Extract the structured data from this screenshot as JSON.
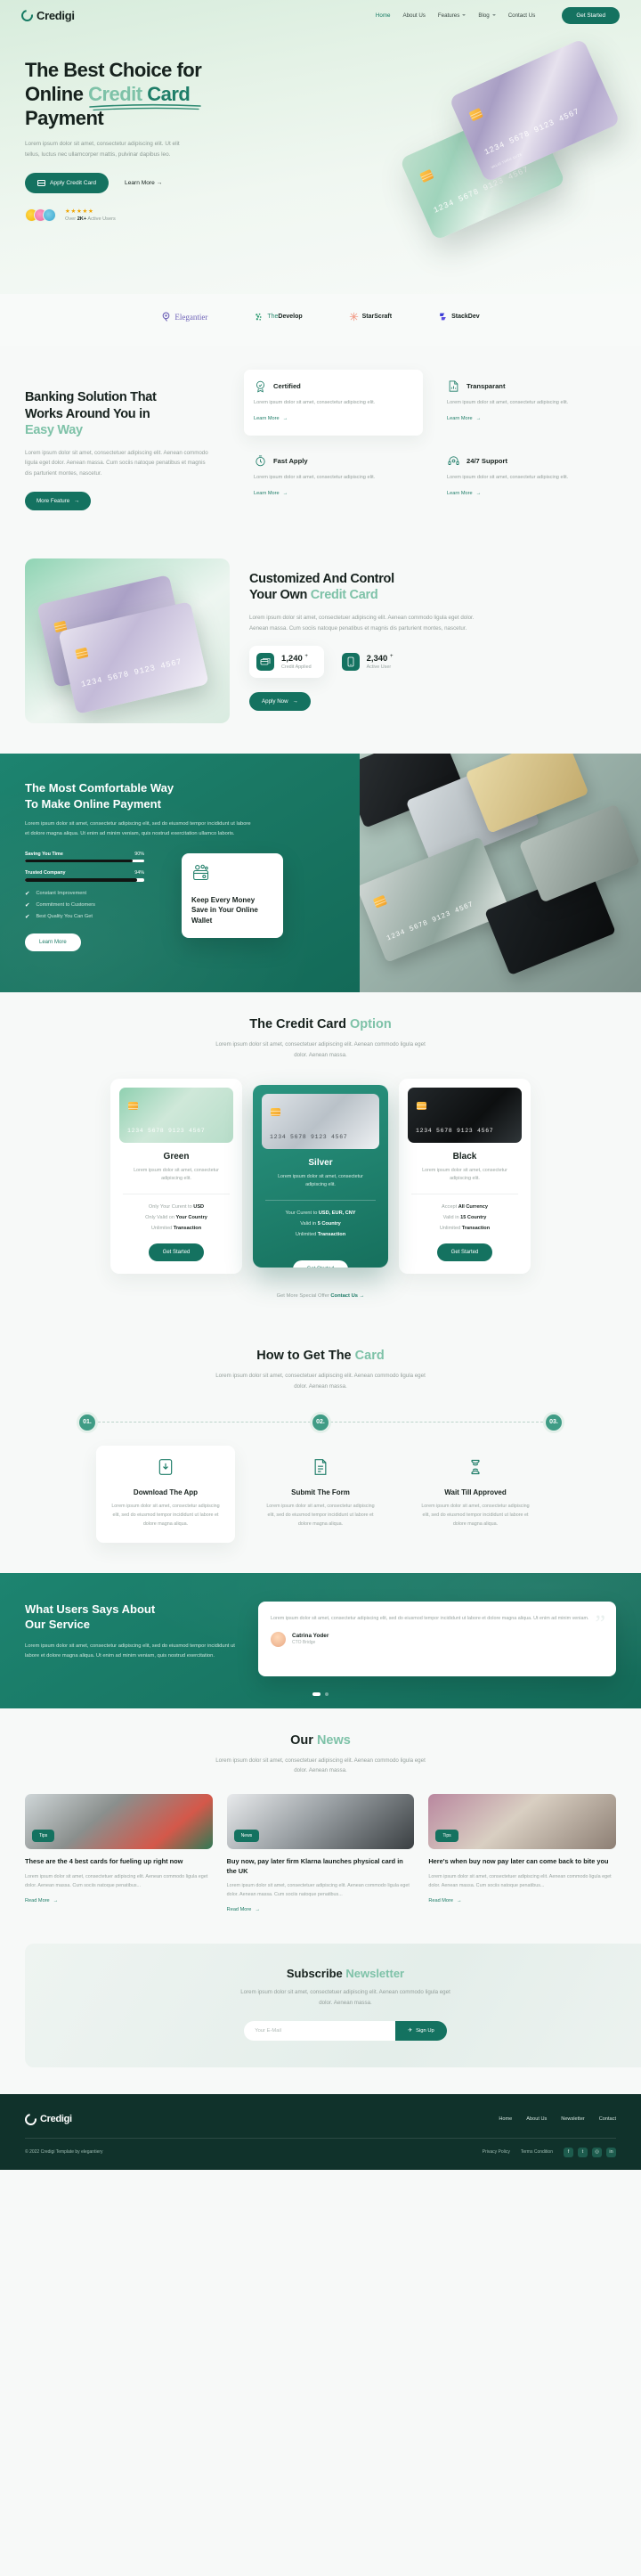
{
  "brand": {
    "name": "Credigi",
    "logo_icon": "credigi-swirl-logo"
  },
  "nav": {
    "links": [
      {
        "label": "Home",
        "active": true,
        "dropdown": false
      },
      {
        "label": "About Us",
        "active": false,
        "dropdown": false
      },
      {
        "label": "Features",
        "active": false,
        "dropdown": true
      },
      {
        "label": "Blog",
        "active": false,
        "dropdown": true
      },
      {
        "label": "Contact Us",
        "active": false,
        "dropdown": false
      }
    ],
    "cta": "Get Started"
  },
  "hero": {
    "title_line1": "The Best Choice for",
    "title_line2_plain": "Online ",
    "title_line2_hl_a": "Credit",
    "title_line2_hl_b": " Card",
    "title_line3": "Payment",
    "paragraph": "Lorem ipsum dolor sit amet, consectetur adipiscing elit. Ut elit tellus, luctus nec ullamcorper mattis, pulvinar dapibus leo.",
    "primary_btn": "Apply Credit Card",
    "secondary_link": "Learn More",
    "stars": "★★★★★",
    "rating_prefix": "Over ",
    "rating_bold": "2K+",
    "rating_suffix": " Active Users",
    "card_number": "1234  5678  9123  4567",
    "card_footer": "VALID THRU  11/28"
  },
  "partners": [
    {
      "name": "Elegantier",
      "icon": "elegantier-logo"
    },
    {
      "name_thin": "The",
      "name_bold": "Develop",
      "icon": "thedevelop-logo"
    },
    {
      "name": "StarScraft",
      "icon": "starscraft-logo"
    },
    {
      "name": "StackDev",
      "icon": "stackdev-logo"
    }
  ],
  "banking": {
    "title_line1": "Banking Solution That",
    "title_line2": "Works Around You in",
    "title_hl": "Easy Way",
    "paragraph": "Lorem ipsum dolor sit amet, consectetuer adipiscing elit. Aenean commodo ligula eget dolor. Aenean massa. Cum sociis natoque penatibus et magnis dis parturient montes, nascetur.",
    "button": "More Feature",
    "features": [
      {
        "name": "Certified",
        "icon": "badge-check-icon",
        "desc": "Lorem ipsum dolor sit amet, consectetur adipiscing elit.",
        "link": "Learn More",
        "boxed": true
      },
      {
        "name": "Transparant",
        "icon": "report-chart-icon",
        "desc": "Lorem ipsum dolor sit amet, consectetur adipiscing elit.",
        "link": "Learn More",
        "boxed": false
      },
      {
        "name": "Fast Apply",
        "icon": "stopwatch-icon",
        "desc": "Lorem ipsum dolor sit amet, consectetur adipiscing elit.",
        "link": "Learn More",
        "boxed": false
      },
      {
        "name": "24/7 Support",
        "icon": "headset-icon",
        "desc": "Lorem ipsum dolor sit amet, consectetur adipiscing elit.",
        "link": "Learn More",
        "boxed": false
      }
    ]
  },
  "customized": {
    "title_line1": "Customized And Control",
    "title_line2_plain": "Your Own ",
    "title_line2_hl": "Credit Card",
    "paragraph": "Lorem ipsum dolor sit amet, consectetuer adipiscing elit. Aenean commodo ligula eget dolor. Aenean massa. Cum sociis natoque penatibus et magnis dis parturient montes, nascetur.",
    "stats": [
      {
        "value": "1,240",
        "plus": "+",
        "label": "Credit Applied",
        "icon": "credit-card-stack-icon"
      },
      {
        "value": "2,340",
        "plus": "+",
        "label": "Active User",
        "icon": "mobile-phone-icon"
      }
    ],
    "button": "Apply Now",
    "card_number": "1234  5678  9123  4567"
  },
  "comfort": {
    "title_line1": "The Most Comfortable Way",
    "title_line2": "To Make Online Payment",
    "paragraph": "Lorem ipsum dolor sit amet, consectetur adipiscing elit, sed do eiusmod tempor incididunt ut labore et dolore magna aliqua. Ut enim ad minim veniam, quis nostrud exercitation ullamco laboris.",
    "bars": [
      {
        "label": "Saving You Time",
        "value": "90%",
        "pct": 90
      },
      {
        "label": "Trusted Company",
        "value": "94%",
        "pct": 94
      }
    ],
    "checks": [
      "Constant Improvement",
      "Commitment to Customers",
      "Best Quality You Can Get"
    ],
    "button": "Learn More",
    "wallet_card": {
      "icon": "wallet-coins-icon",
      "title": "Keep Every Money Save in Your Online Wallet"
    }
  },
  "pricing": {
    "title_plain": "The Credit Card ",
    "title_hl": "Option",
    "subtitle": "Lorem ipsum dolor sit amet, consectetuer adipiscing elit. Aenean commodo ligula eget dolor. Aenean massa.",
    "plans": [
      {
        "name": "Green",
        "art": "green",
        "desc": "Lorem ipsum dolor sit amet, consectetur adipiscing elit.",
        "lines": [
          {
            "pre": "Only Your Curent to ",
            "bold": "USD",
            "post": ""
          },
          {
            "pre": "Only Valid on ",
            "bold": "Your Country",
            "post": ""
          },
          {
            "pre": "Unlimited ",
            "bold": "Transaction",
            "post": ""
          }
        ],
        "button": "Get Started",
        "featured": false,
        "card_number": "1234 5678 9123 4567"
      },
      {
        "name": "Silver",
        "art": "silver",
        "desc": "Lorem ipsum dolor sit amet, consectetur adipiscing elit.",
        "lines": [
          {
            "pre": "Your Curent to ",
            "bold": "USD, EUR, CNY",
            "post": ""
          },
          {
            "pre": "Valid in ",
            "bold": "5 Country",
            "post": ""
          },
          {
            "pre": "Unlimited ",
            "bold": "Transaction",
            "post": ""
          }
        ],
        "button": "Get Started",
        "featured": true,
        "card_number": "1234 5678 9123 4567"
      },
      {
        "name": "Black",
        "art": "black",
        "desc": "Lorem ipsum dolor sit amet, consectetur adipiscing elit.",
        "lines": [
          {
            "pre": "Accept ",
            "bold": "All Currency",
            "post": ""
          },
          {
            "pre": "Valid in ",
            "bold": "15 Country",
            "post": ""
          },
          {
            "pre": "Unlimited ",
            "bold": "Transaction",
            "post": ""
          }
        ],
        "button": "Get Started",
        "featured": false,
        "card_number": "1234 5678 9123 4567"
      }
    ],
    "special_text": "Get More Special Offer ",
    "special_link": "Contact Us"
  },
  "howto": {
    "title_plain": "How to Get The ",
    "title_hl": "Card",
    "subtitle": "Lorem ipsum dolor sit amet, consectetuer adipiscing elit. Aenean commodo ligula eget dolor. Aenean massa.",
    "steps": [
      {
        "num": "01.",
        "title": "Download The App",
        "icon": "app-download-icon",
        "desc": "Lorem ipsum dolor sit amet, consectetur adipiscing elit, sed do eiusmod tempor incididunt ut labore et dolore magna aliqua.",
        "boxed": true
      },
      {
        "num": "02.",
        "title": "Submit The Form",
        "icon": "form-document-icon",
        "desc": "Lorem ipsum dolor sit amet, consectetur adipiscing elit, sed do eiusmod tempor incididunt ut labore et dolore magna aliqua.",
        "boxed": false
      },
      {
        "num": "03.",
        "title": "Wait Till Approved",
        "icon": "hourglass-clock-icon",
        "desc": "Lorem ipsum dolor sit amet, consectetur adipiscing elit, sed do eiusmod tempor incididunt ut labore et dolore magna aliqua.",
        "boxed": false
      }
    ]
  },
  "testimonial": {
    "title_line1": "What Users Says About",
    "title_line2": "Our Service",
    "paragraph": "Lorem ipsum dolor sit amet, consectetur adipiscing elit, sed do eiusmod tempor incididunt ut labore et dolore magna aliqua. Ut enim ad minim veniam, quis nostrud exercitation.",
    "quote": "Lorem ipsum dolor sit amet, consectetur adipiscing elit, sed do eiusmod tempor incididunt ut labore et dolore magna aliqua. Ut enim ad minim veniam.",
    "author": "Catrina Yoder",
    "role": "CTO Bridge",
    "dots": 2
  },
  "news": {
    "title_plain": "Our ",
    "title_hl": "News",
    "subtitle": "Lorem ipsum dolor sit amet, consectetuer adipiscing elit. Aenean commodo ligula eget dolor. Aenean massa.",
    "items": [
      {
        "tag": "Tips",
        "title": "These are the 4 best cards for fueling up right now",
        "desc": "Lorem ipsum dolor sit amet, consectetuer adipiscing elit. Aenean commodo ligula eget dolor. Aenean massa. Cum sociis natoque penatibus...",
        "link": "Read More"
      },
      {
        "tag": "News",
        "title": "Buy now, pay later firm Klarna launches physical card in the UK",
        "desc": "Lorem ipsum dolor sit amet, consectetuer adipiscing elit. Aenean commodo ligula eget dolor. Aenean massa. Cum sociis natoque penatibus...",
        "link": "Read More"
      },
      {
        "tag": "Tips",
        "title": "Here's when buy now pay later can come back to bite you",
        "desc": "Lorem ipsum dolor sit amet, consectetuer adipiscing elit. Aenean commodo ligula eget dolor. Aenean massa. Cum sociis natoque penatibus...",
        "link": "Read More"
      }
    ]
  },
  "subscribe": {
    "title_plain": "Subscribe ",
    "title_hl": "Newsletter",
    "subtitle": "Lorem ipsum dolor sit amet, consectetuer adipiscing elit. Aenean commodo ligula eget dolor. Aenean massa.",
    "placeholder": "Your E-Mail",
    "button": "Sign Up"
  },
  "footer": {
    "logo": "Credigi",
    "links": [
      "Home",
      "About Us",
      "Newsletter",
      "Contact"
    ],
    "policies": [
      "Privacy Policy",
      "Terms Condition"
    ],
    "copyright": "© 2022 Credigi Template by elegantiery",
    "socials": [
      "facebook-icon",
      "twitter-icon",
      "instagram-icon",
      "linkedin-icon"
    ]
  },
  "colors": {
    "accent": "#147260",
    "accent_light": "#7ec2a8",
    "dark": "#10322b"
  }
}
